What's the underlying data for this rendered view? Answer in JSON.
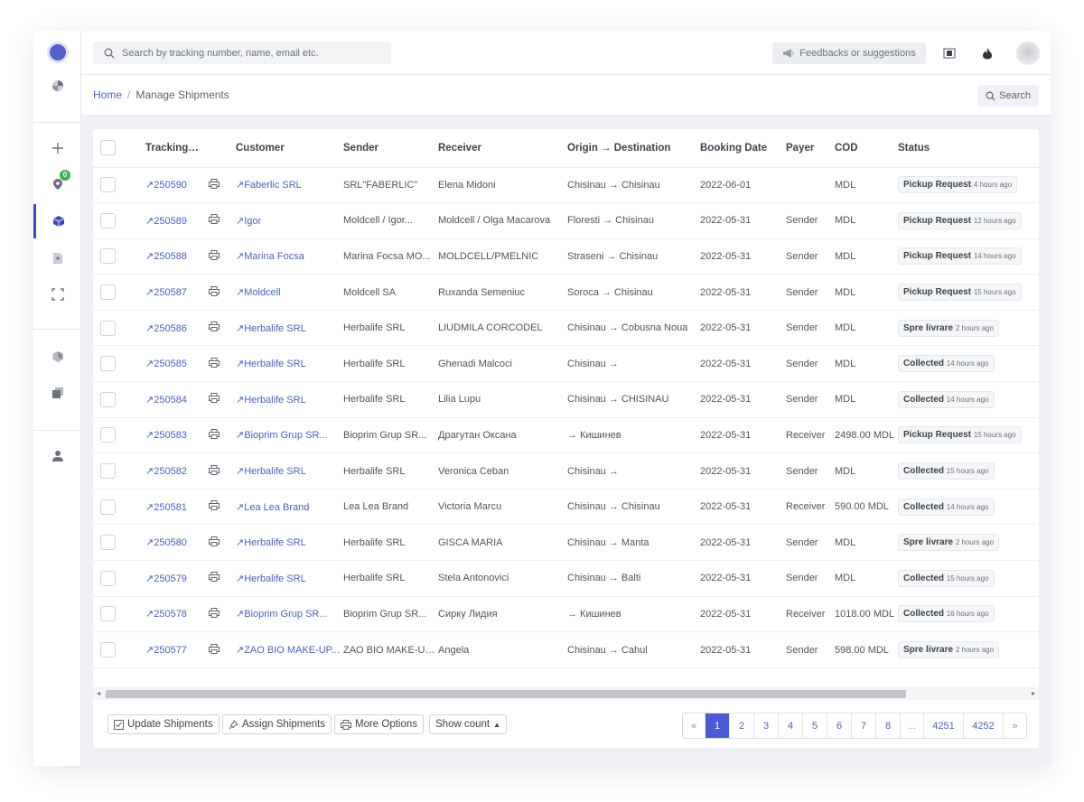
{
  "topbar": {
    "search_placeholder": "Search by tracking number, name, email etc.",
    "feedback_label": "Feedbacks or suggestions",
    "icons": [
      "search-icon",
      "megaphone-icon",
      "window-icon",
      "flame-icon",
      "avatar"
    ]
  },
  "sidebar": {
    "badge_count": "0",
    "items": [
      "logo",
      "pie-chart-icon",
      "plus-icon",
      "map-pin-icon",
      "box-icon",
      "file-icon",
      "scan-icon",
      "hexagon-icon",
      "copy-icon",
      "user-icon"
    ],
    "active_item": "box-icon"
  },
  "breadcrumb": {
    "home": "Home",
    "separator": "/",
    "current": "Manage Shipments"
  },
  "search_button_label": "Search",
  "table": {
    "columns": {
      "tracking": "Tracking No.",
      "customer": "Customer",
      "sender": "Sender",
      "receiver": "Receiver",
      "route": "Origin → Destination",
      "booking": "Booking Date",
      "payer": "Payer",
      "cod": "COD",
      "status": "Status"
    },
    "rows": [
      {
        "tracking": "↗250590",
        "customer": "↗Faberlic SRL",
        "sender": "SRL\"FABERLIC\"",
        "receiver": "Elena Midoni",
        "route": "Chisinau → Chisinau",
        "booking": "2022-06-01",
        "payer": "",
        "cod": "MDL",
        "status": "Pickup Request",
        "ago": "4 hours ago"
      },
      {
        "tracking": "↗250589",
        "customer": "↗Igor",
        "sender": "Moldcell / Igor...",
        "receiver": "Moldcell / Olga Macarova",
        "route": "Floresti → Chisinau",
        "booking": "2022-05-31",
        "payer": "Sender",
        "cod": "MDL",
        "status": "Pickup Request",
        "ago": "12 hours ago"
      },
      {
        "tracking": "↗250588",
        "customer": "↗Marina Focsa",
        "sender": "Marina Focsa MO...",
        "receiver": "MOLDCELL/PMELNIC",
        "route": "Straseni → Chisinau",
        "booking": "2022-05-31",
        "payer": "Sender",
        "cod": "MDL",
        "status": "Pickup Request",
        "ago": "14 hours ago"
      },
      {
        "tracking": "↗250587",
        "customer": "↗Moldcell",
        "sender": "Moldcell SA",
        "receiver": "Ruxanda Semeniuc",
        "route": "Soroca → Chisinau",
        "booking": "2022-05-31",
        "payer": "Sender",
        "cod": "MDL",
        "status": "Pickup Request",
        "ago": "15 hours ago"
      },
      {
        "tracking": "↗250586",
        "customer": "↗Herbalife SRL",
        "sender": "Herbalife SRL",
        "receiver": "LIUDMILA CORCODEL",
        "route": "Chisinau → Cobusna Noua",
        "booking": "2022-05-31",
        "payer": "Sender",
        "cod": "MDL",
        "status": "Spre livrare",
        "ago": "2 hours ago"
      },
      {
        "tracking": "↗250585",
        "customer": "↗Herbalife SRL",
        "sender": "Herbalife SRL",
        "receiver": "Ghenadi Malcoci",
        "route": "Chisinau →",
        "booking": "2022-05-31",
        "payer": "Sender",
        "cod": "MDL",
        "status": "Collected",
        "ago": "14 hours ago"
      },
      {
        "tracking": "↗250584",
        "customer": "↗Herbalife SRL",
        "sender": "Herbalife SRL",
        "receiver": "Lilia Lupu",
        "route": "Chisinau → CHISINAU",
        "booking": "2022-05-31",
        "payer": "Sender",
        "cod": "MDL",
        "status": "Collected",
        "ago": "14 hours ago"
      },
      {
        "tracking": "↗250583",
        "customer": "↗Bioprim Grup SR...",
        "sender": "Bioprim Grup SR...",
        "receiver": "Драгутан Оксана",
        "route": "→ Кишинев",
        "booking": "2022-05-31",
        "payer": "Receiver",
        "cod": "2498.00 MDL",
        "status": "Pickup Request",
        "ago": "15 hours ago"
      },
      {
        "tracking": "↗250582",
        "customer": "↗Herbalife SRL",
        "sender": "Herbalife SRL",
        "receiver": "Veronica Ceban",
        "route": "Chisinau →",
        "booking": "2022-05-31",
        "payer": "Sender",
        "cod": "MDL",
        "status": "Collected",
        "ago": "15 hours ago"
      },
      {
        "tracking": "↗250581",
        "customer": "↗Lea Lea Brand",
        "sender": "Lea Lea Brand",
        "receiver": "Victoria Marcu",
        "route": "Chisinau → Chisinau",
        "booking": "2022-05-31",
        "payer": "Receiver",
        "cod": "590.00 MDL",
        "status": "Collected",
        "ago": "14 hours ago"
      },
      {
        "tracking": "↗250580",
        "customer": "↗Herbalife SRL",
        "sender": "Herbalife SRL",
        "receiver": "GISCA MARIA",
        "route": "Chisinau → Manta",
        "booking": "2022-05-31",
        "payer": "Sender",
        "cod": "MDL",
        "status": "Spre livrare",
        "ago": "2 hours ago"
      },
      {
        "tracking": "↗250579",
        "customer": "↗Herbalife SRL",
        "sender": "Herbalife SRL",
        "receiver": "Stela Antonovici",
        "route": "Chisinau → Balti",
        "booking": "2022-05-31",
        "payer": "Sender",
        "cod": "MDL",
        "status": "Collected",
        "ago": "15 hours ago"
      },
      {
        "tracking": "↗250578",
        "customer": "↗Bioprim Grup SR...",
        "sender": "Bioprim Grup SR...",
        "receiver": "Сирку Лидия",
        "route": "→ Кишинев",
        "booking": "2022-05-31",
        "payer": "Receiver",
        "cod": "1018.00 MDL",
        "status": "Collected",
        "ago": "16 hours ago"
      },
      {
        "tracking": "↗250577",
        "customer": "↗ZAO BIO MAKE-UP...",
        "sender": "ZAO BIO MAKE-UP...",
        "receiver": "Angela",
        "route": "Chisinau → Cahul",
        "booking": "2022-05-31",
        "payer": "Sender",
        "cod": "598.00 MDL",
        "status": "Spre livrare",
        "ago": "2 hours ago"
      }
    ]
  },
  "footer": {
    "update_label": "Update Shipments",
    "assign_label": "Assign Shipments",
    "more_label": "More Options",
    "show_count_label": "Show count",
    "pages": [
      "«",
      "1",
      "2",
      "3",
      "4",
      "5",
      "6",
      "7",
      "8",
      "...",
      "4251",
      "4252",
      "»"
    ],
    "active_page": "1"
  },
  "colors": {
    "accent": "#4b5ad3",
    "link": "#4a63b5",
    "badge": "#37b24d"
  }
}
